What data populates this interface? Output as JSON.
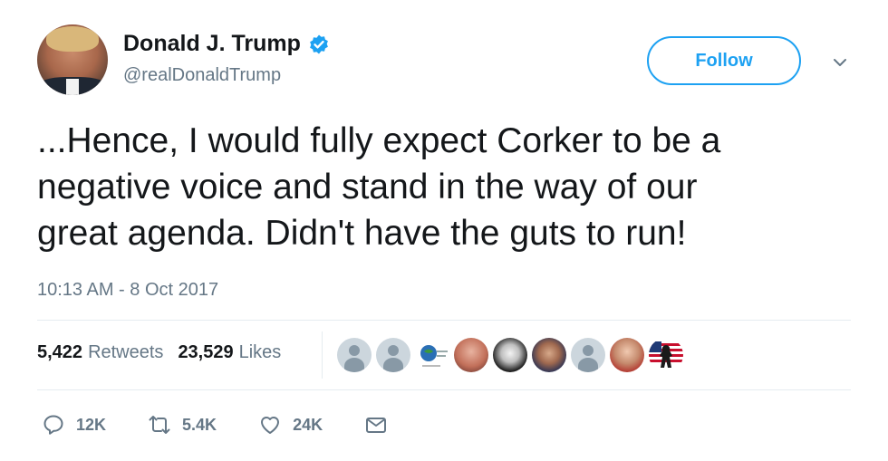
{
  "user": {
    "display_name": "Donald J. Trump",
    "handle": "@realDonaldTrump",
    "verified": true
  },
  "header": {
    "follow_label": "Follow"
  },
  "tweet": {
    "text": "...Hence, I would fully expect Corker to be a\nnegative voice and stand in the way of our\ngreat agenda. Didn't have the guts to run!",
    "timestamp": "10:13 AM - 8 Oct 2017"
  },
  "stats": {
    "retweets_count": "5,422",
    "retweets_label": "Retweets",
    "likes_count": "23,529",
    "likes_label": "Likes"
  },
  "likers": [
    {
      "kind": "default"
    },
    {
      "kind": "default"
    },
    {
      "kind": "logo"
    },
    {
      "kind": "photo"
    },
    {
      "kind": "photo"
    },
    {
      "kind": "photo"
    },
    {
      "kind": "default"
    },
    {
      "kind": "photo"
    },
    {
      "kind": "flag"
    }
  ],
  "actions": {
    "reply_count": "12K",
    "retweet_count": "5.4K",
    "like_count": "24K"
  },
  "colors": {
    "accent": "#1da1f2",
    "text": "#14171a",
    "secondary": "#657786",
    "divider": "#e6ecf0"
  }
}
